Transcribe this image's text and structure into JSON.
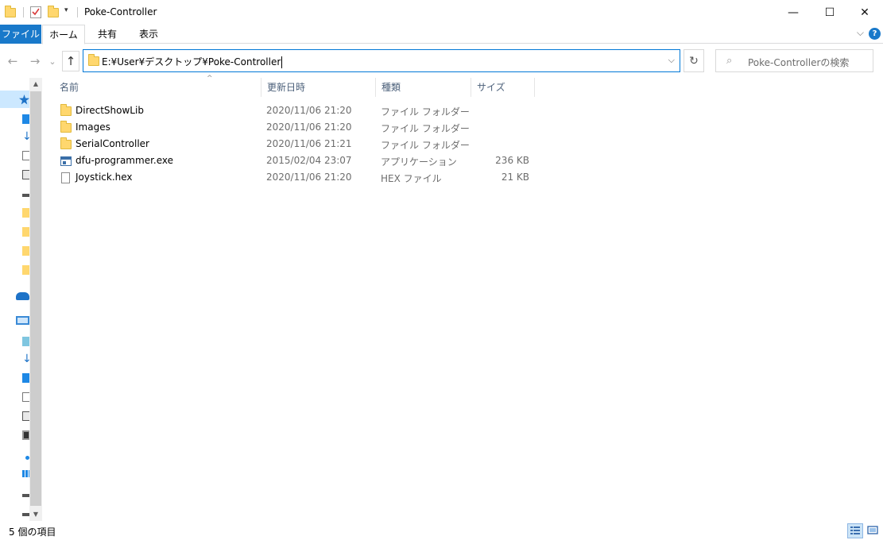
{
  "window": {
    "title": "Poke-Controller",
    "minimize": "—",
    "maximize": "☐",
    "close": "✕"
  },
  "quick_access": {
    "customize_glyph": "▾"
  },
  "ribbon": {
    "tabs": [
      "ファイル",
      "ホーム",
      "共有",
      "表示"
    ],
    "expand_glyph": "⌵",
    "help_glyph": "?"
  },
  "nav": {
    "back_glyph": "←",
    "forward_glyph": "→",
    "recent_glyph": "⌄",
    "up_glyph": "↑",
    "address": "E:¥User¥デスクトップ¥Poke-Controller",
    "address_drop_glyph": "⌵",
    "refresh_glyph": "↻",
    "search_glyph": "⌕",
    "search_placeholder": "Poke-Controllerの検索"
  },
  "columns": {
    "name": "名前",
    "date": "更新日時",
    "type": "種類",
    "size": "サイズ",
    "sort_glyph": "^"
  },
  "files": [
    {
      "name": "DirectShowLib",
      "date": "2020/11/06 21:20",
      "type": "ファイル フォルダー",
      "size": "",
      "icon": "folder-icon"
    },
    {
      "name": "Images",
      "date": "2020/11/06 21:20",
      "type": "ファイル フォルダー",
      "size": "",
      "icon": "folder-icon"
    },
    {
      "name": "SerialController",
      "date": "2020/11/06 21:21",
      "type": "ファイル フォルダー",
      "size": "",
      "icon": "folder-icon"
    },
    {
      "name": "dfu-programmer.exe",
      "date": "2015/02/04 23:07",
      "type": "アプリケーション",
      "size": "236 KB",
      "icon": "application-icon"
    },
    {
      "name": "Joystick.hex",
      "date": "2020/11/06 21:20",
      "type": "HEX ファイル",
      "size": "21 KB",
      "icon": "document-icon"
    }
  ],
  "status": {
    "item_count": "5 個の項目"
  },
  "scrollbar": {
    "up_glyph": "▲",
    "down_glyph": "▼"
  },
  "colors": {
    "accent": "#0078d7",
    "file_tab": "#1979ca",
    "folder": "#ffd76e"
  }
}
